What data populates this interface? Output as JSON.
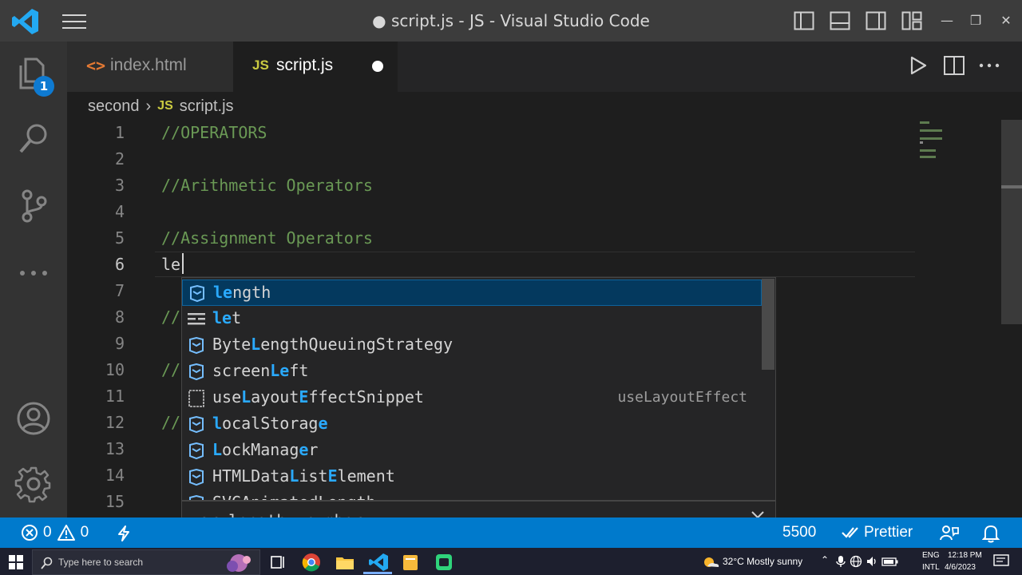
{
  "window": {
    "title": "● script.js - JS - Visual Studio Code"
  },
  "activity_bar": {
    "explorer_badge": "1",
    "icons": [
      "files-icon",
      "search-icon",
      "source-control-icon",
      "more-icon",
      "account-icon",
      "settings-gear-icon"
    ]
  },
  "tabs": [
    {
      "label": "index.html",
      "icon": "<>",
      "active": false
    },
    {
      "label": "script.js",
      "icon": "JS",
      "active": true,
      "dirty": true
    }
  ],
  "breadcrumb": {
    "folder": "second",
    "separator": "›",
    "file_icon": "JS",
    "file": "script.js"
  },
  "editor": {
    "line_numbers": [
      "1",
      "2",
      "3",
      "4",
      "5",
      "6",
      "7",
      "8",
      "9",
      "10",
      "11",
      "12",
      "13",
      "14",
      "15"
    ],
    "lines": [
      {
        "text": "//OPERATORS",
        "kind": "comment"
      },
      {
        "text": "",
        "kind": "plain"
      },
      {
        "text": "//Arithmetic Operators",
        "kind": "comment"
      },
      {
        "text": "",
        "kind": "plain"
      },
      {
        "text": "//Assignment Operators",
        "kind": "comment"
      },
      {
        "text": "le",
        "kind": "plain"
      },
      {
        "text": "",
        "kind": "plain"
      },
      {
        "text": "//",
        "kind": "comment"
      },
      {
        "text": "",
        "kind": "plain"
      },
      {
        "text": "//",
        "kind": "comment"
      },
      {
        "text": "",
        "kind": "plain"
      },
      {
        "text": "//",
        "kind": "comment"
      },
      {
        "text": "",
        "kind": "plain"
      },
      {
        "text": "",
        "kind": "plain"
      },
      {
        "text": "",
        "kind": "plain"
      }
    ]
  },
  "suggestions": [
    {
      "parts": [
        [
          "le",
          true
        ],
        [
          "ngth",
          false
        ]
      ],
      "icon": "variable-icon",
      "detail": ""
    },
    {
      "parts": [
        [
          "le",
          true
        ],
        [
          "t",
          false
        ]
      ],
      "icon": "keyword-icon",
      "detail": ""
    },
    {
      "parts": [
        [
          "Byte",
          false
        ],
        [
          "L",
          true
        ],
        [
          "ength",
          false
        ],
        [
          "QueuingStrategy",
          false
        ]
      ],
      "icon": "variable-icon",
      "detail": ""
    },
    {
      "parts": [
        [
          "screen",
          false
        ],
        [
          "Le",
          true
        ],
        [
          "ft",
          false
        ]
      ],
      "icon": "variable-icon",
      "detail": ""
    },
    {
      "parts": [
        [
          "use",
          false
        ],
        [
          "L",
          true
        ],
        [
          "ayout",
          false
        ],
        [
          "E",
          true
        ],
        [
          "ffectSnippet",
          false
        ]
      ],
      "icon": "snippet-icon",
      "detail": "useLayoutEffect"
    },
    {
      "parts": [
        [
          "l",
          true
        ],
        [
          "ocalStorag",
          false
        ],
        [
          "e",
          true
        ]
      ],
      "icon": "variable-icon",
      "detail": ""
    },
    {
      "parts": [
        [
          "L",
          true
        ],
        [
          "ockManag",
          false
        ],
        [
          "e",
          true
        ],
        [
          "r",
          false
        ]
      ],
      "icon": "variable-icon",
      "detail": ""
    },
    {
      "parts": [
        [
          "HTMLData",
          false
        ],
        [
          "L",
          true
        ],
        [
          "ist",
          false
        ],
        [
          "E",
          true
        ],
        [
          "lement",
          false
        ]
      ],
      "icon": "variable-icon",
      "detail": ""
    },
    {
      "parts": [
        [
          "SVGAnimatedLength",
          false
        ]
      ],
      "icon": "variable-icon",
      "detail": ""
    }
  ],
  "details": {
    "signature": "var length: number"
  },
  "status_bar": {
    "errors": "0",
    "warnings": "0",
    "port": "5500",
    "prettier": "Prettier"
  },
  "taskbar": {
    "search_placeholder": "Type here to search",
    "weather": "32°C  Mostly sunny",
    "lang_top": "ENG",
    "lang_bottom": "INTL",
    "time": "12:18 PM",
    "date": "4/6/2023"
  }
}
